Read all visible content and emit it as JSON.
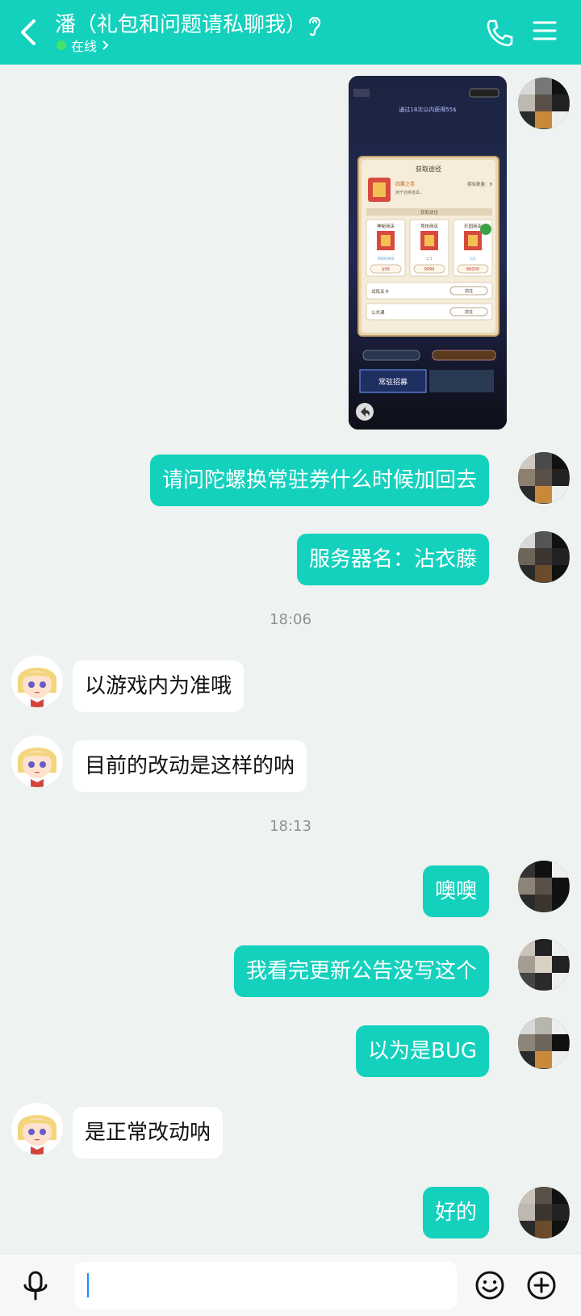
{
  "header": {
    "title": "潘（礼包和问题请私聊我）",
    "status": "在线",
    "colors": {
      "bar": "#14d1bd",
      "online_dot": "#46e36a"
    },
    "icons": [
      "back-icon",
      "ear-icon",
      "phone-icon",
      "menu-icon"
    ]
  },
  "shot": {
    "top_text": "通过18次以内获得55$",
    "dialog_title": "获取途径",
    "item_name": "四翼之卷",
    "item_desc": "用于召唤道具..",
    "owned": "拥有数量：8",
    "section": "获取途径",
    "shops": [
      {
        "name": "神秘商店",
        "limit": "999/999",
        "price": "$99"
      },
      {
        "name": "竞技商店",
        "limit": "1/1",
        "price": "9999"
      },
      {
        "name": "乐园商店",
        "limit": "1/1",
        "price": "80000"
      }
    ],
    "rows": [
      {
        "label": "试炼关卡",
        "action": "前往"
      },
      {
        "label": "公共课",
        "action": "前往"
      }
    ],
    "banner": "常驻招募"
  },
  "messages": [
    {
      "text": "请问陀螺换常驻券什么时候加回去"
    },
    {
      "text": "服务器名：沾衣藤"
    },
    {
      "time": "18:06"
    },
    {
      "text": "以游戏内为准哦"
    },
    {
      "text": "目前的改动是这样的呐"
    },
    {
      "time": "18:13"
    },
    {
      "text": "噢噢"
    },
    {
      "text": "我看完更新公告没写这个"
    },
    {
      "text": "以为是BUG"
    },
    {
      "text": "是正常改动呐"
    },
    {
      "text": "好的"
    }
  ],
  "footer": {
    "icons": [
      "mic-icon",
      "emoji-icon",
      "plus-icon"
    ],
    "input_value": ""
  },
  "colors": {
    "outgoing_bubble": "#14d1bd",
    "incoming_bubble": "#ffffff",
    "background": "#eef2f0"
  }
}
